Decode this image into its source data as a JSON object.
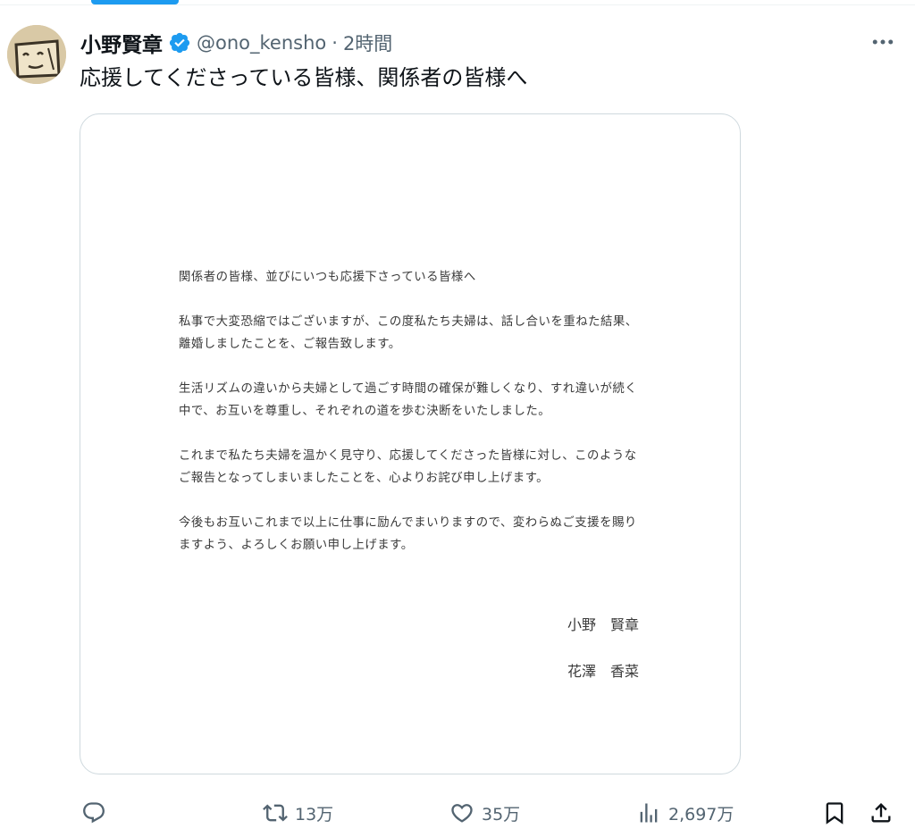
{
  "tweet": {
    "display_name": "小野賢章",
    "handle": "@ono_kensho",
    "separator": "·",
    "time": "2時間",
    "text": "応援してくださっている皆様、関係者の皆様へ"
  },
  "letter": {
    "greeting": "関係者の皆様、並びにいつも応援下さっている皆様へ",
    "paragraphs": [
      "私事で大変恐縮ではございますが、この度私たち夫婦は、話し合いを重ねた結果、\n離婚しましたことを、ご報告致します。",
      "生活リズムの違いから夫婦として過ごす時間の確保が難しくなり、すれ違いが続く\n中で、お互いを尊重し、それぞれの道を歩む決断をいたしました。",
      "これまで私たち夫婦を温かく見守り、応援してくださった皆様に対し、このような\nご報告となってしまいましたことを、心よりお詫び申し上げます。",
      "今後もお互いこれまで以上に仕事に励んでまいりますので、変わらぬご支援を賜り\nますよう、よろしくお願い申し上げます。"
    ],
    "signatures": [
      "小野　賢章",
      "花澤　香菜"
    ]
  },
  "actions": {
    "retweets": "13万",
    "likes": "35万",
    "views": "2,697万"
  },
  "icons": {
    "verified": "verified-badge-icon",
    "more": "more-icon",
    "reply": "reply-icon",
    "retweet": "retweet-icon",
    "like": "heart-icon",
    "views": "views-chart-icon",
    "bookmark": "bookmark-icon",
    "share": "share-icon"
  },
  "colors": {
    "accent": "#1d9bf0",
    "text": "#0f1419",
    "muted": "#536471"
  }
}
